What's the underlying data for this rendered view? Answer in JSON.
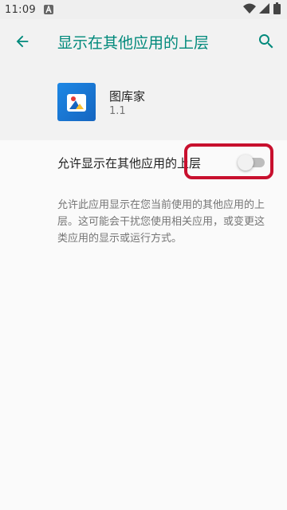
{
  "status_bar": {
    "time": "11:09",
    "notification_icon": "a-letter-icon",
    "icons": [
      "wifi-icon",
      "signal-icon",
      "battery-icon"
    ]
  },
  "appbar": {
    "title": "显示在其他应用的上层",
    "back_icon": "arrow-left-icon",
    "search_icon": "search-icon",
    "accent_color": "#00897b"
  },
  "app": {
    "name": "图库家",
    "version": "1.1"
  },
  "preference": {
    "title": "允许显示在其他应用的上层",
    "toggle_on": false,
    "summary": "允许此应用显示在您当前使用的其他应用的上层。这可能会干扰您使用相关应用，或变更这类应用的显示或运行方式。",
    "highlight_color": "#c8102e"
  }
}
